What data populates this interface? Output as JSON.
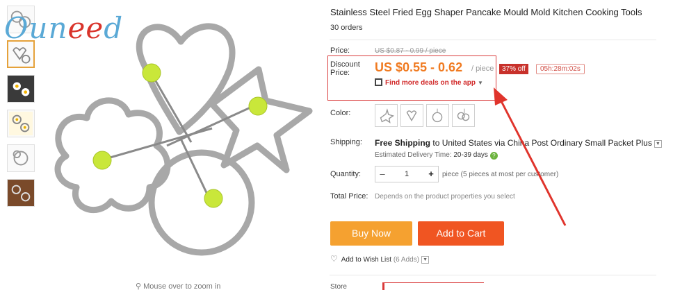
{
  "watermark": {
    "brand": "Oun",
    "dots": "ee",
    "rest": "d"
  },
  "product": {
    "title": "Stainless Steel Fried Egg Shaper Pancake Mould Mold Kitchen Cooking Tools",
    "orders": "30 orders"
  },
  "gallery": {
    "zoom_hint": "Mouse over to zoom in",
    "thumbnails": [
      "thumb-1",
      "thumb-2",
      "thumb-3",
      "thumb-4",
      "thumb-5",
      "thumb-6"
    ]
  },
  "price": {
    "label": "Price:",
    "original": "US $0.87 - 0.99 / piece",
    "discount_label_1": "Discount",
    "discount_label_2": "Price:",
    "current": "US $0.55 - 0.62",
    "unit": "/ piece",
    "off_badge": "37% off",
    "timer": "05h:28m:02s",
    "deals_link": "Find more deals on the app"
  },
  "color": {
    "label": "Color:",
    "options": [
      "star",
      "heart",
      "round",
      "flower"
    ]
  },
  "shipping": {
    "label": "Shipping:",
    "free": "Free Shipping",
    "to": "to",
    "destination": "United States via China Post Ordinary Small Packet Plus",
    "est_label": "Estimated Delivery Time:",
    "est_days": "20-39 days"
  },
  "quantity": {
    "label": "Quantity:",
    "value": "1",
    "note": "piece (5 pieces at most per customer)"
  },
  "total": {
    "label": "Total Price:",
    "note": "Depends on the product properties you select"
  },
  "buttons": {
    "buy_now": "Buy Now",
    "add_to_cart": "Add to Cart"
  },
  "wishlist": {
    "label": "Add to Wish List",
    "count": "(6 Adds)"
  },
  "store": {
    "label": "Store"
  },
  "colors": {
    "buy": "#f5a130",
    "cart": "#f05522",
    "price": "#f07a20",
    "alert": "#d93a3a"
  }
}
